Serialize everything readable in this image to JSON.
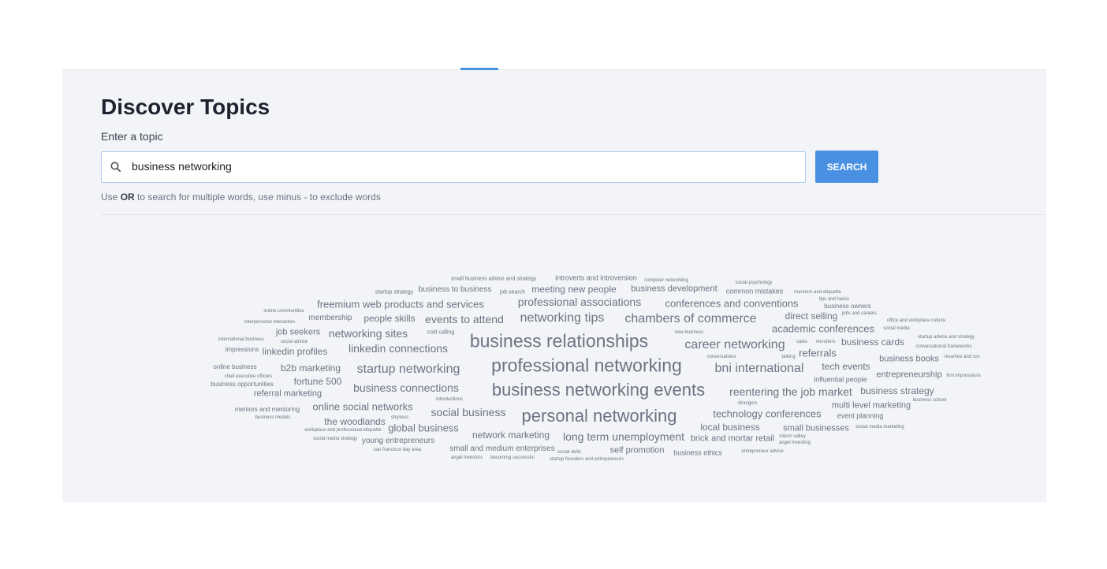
{
  "header": {
    "title": "Discover Topics",
    "input_label": "Enter a topic"
  },
  "search": {
    "value": "business networking",
    "button_label": "SEARCH",
    "help_prefix": "Use ",
    "help_bold": "OR",
    "help_suffix": " to search for multiple words, use minus - to exclude words",
    "icon": "search-icon"
  },
  "colors": {
    "accent": "#4a90e2",
    "panel_bg": "#f3f4f8",
    "word_color": "#6e7382"
  },
  "word_cloud": [
    {
      "text": "small business advice and strategy"
    },
    {
      "text": "introverts and introversion"
    },
    {
      "text": "computer networking"
    },
    {
      "text": "social psychology"
    },
    {
      "text": "startup strategy"
    },
    {
      "text": "business to business"
    },
    {
      "text": "job search"
    },
    {
      "text": "meeting new people"
    },
    {
      "text": "business development"
    },
    {
      "text": "common mistakes"
    },
    {
      "text": "manners and etiquette"
    },
    {
      "text": "tips and hacks"
    },
    {
      "text": "freemium web products and services"
    },
    {
      "text": "professional associations"
    },
    {
      "text": "conferences and conventions"
    },
    {
      "text": "business owners"
    },
    {
      "text": "online communities"
    },
    {
      "text": "jobs and careers"
    },
    {
      "text": "membership"
    },
    {
      "text": "people skills"
    },
    {
      "text": "events to attend"
    },
    {
      "text": "networking tips"
    },
    {
      "text": "chambers of commerce"
    },
    {
      "text": "direct selling"
    },
    {
      "text": "interpersonal interaction"
    },
    {
      "text": "office and workplace culture"
    },
    {
      "text": "academic conferences"
    },
    {
      "text": "social media"
    },
    {
      "text": "job seekers"
    },
    {
      "text": "networking sites"
    },
    {
      "text": "cold calling"
    },
    {
      "text": "new business"
    },
    {
      "text": "international business"
    },
    {
      "text": "startup advice and strategy"
    },
    {
      "text": "social advice"
    },
    {
      "text": "business relationships"
    },
    {
      "text": "career networking"
    },
    {
      "text": "sales"
    },
    {
      "text": "recruiters"
    },
    {
      "text": "business cards"
    },
    {
      "text": "conversational frameworks"
    },
    {
      "text": "impressions"
    },
    {
      "text": "linkedin profiles"
    },
    {
      "text": "linkedin connections"
    },
    {
      "text": "conversations"
    },
    {
      "text": "talking"
    },
    {
      "text": "referrals"
    },
    {
      "text": "resumes and cvs"
    },
    {
      "text": "business books"
    },
    {
      "text": "online business"
    },
    {
      "text": "b2b marketing"
    },
    {
      "text": "startup networking"
    },
    {
      "text": "professional networking"
    },
    {
      "text": "bni international"
    },
    {
      "text": "tech events"
    },
    {
      "text": "chief executive officers"
    },
    {
      "text": "entrepreneurship"
    },
    {
      "text": "first impressions"
    },
    {
      "text": "fortune 500"
    },
    {
      "text": "influential people"
    },
    {
      "text": "business opportunities"
    },
    {
      "text": "business connections"
    },
    {
      "text": "business networking events"
    },
    {
      "text": "referral marketing"
    },
    {
      "text": "reentering the job market"
    },
    {
      "text": "business strategy"
    },
    {
      "text": "introductions"
    },
    {
      "text": "business school"
    },
    {
      "text": "strangers"
    },
    {
      "text": "online social networks"
    },
    {
      "text": "mentors and mentoring"
    },
    {
      "text": "multi level marketing"
    },
    {
      "text": "social business"
    },
    {
      "text": "personal networking"
    },
    {
      "text": "technology conferences"
    },
    {
      "text": "business models"
    },
    {
      "text": "shyness"
    },
    {
      "text": "event planning"
    },
    {
      "text": "the woodlands"
    },
    {
      "text": "local business"
    },
    {
      "text": "small businesses"
    },
    {
      "text": "social media marketing"
    },
    {
      "text": "workplace and professional etiquette"
    },
    {
      "text": "global business"
    },
    {
      "text": "network marketing"
    },
    {
      "text": "long term unemployment"
    },
    {
      "text": "silicon valley"
    },
    {
      "text": "social media strategy"
    },
    {
      "text": "young entrepreneurs"
    },
    {
      "text": "brick and mortar retail"
    },
    {
      "text": "angel investing"
    },
    {
      "text": "san francisco bay area"
    },
    {
      "text": "small and medium enterprises"
    },
    {
      "text": "social skills"
    },
    {
      "text": "self promotion"
    },
    {
      "text": "business ethics"
    },
    {
      "text": "entrepreneur advice"
    },
    {
      "text": "angel investors"
    },
    {
      "text": "becoming successful"
    },
    {
      "text": "startup founders and entrepreneurs"
    }
  ]
}
